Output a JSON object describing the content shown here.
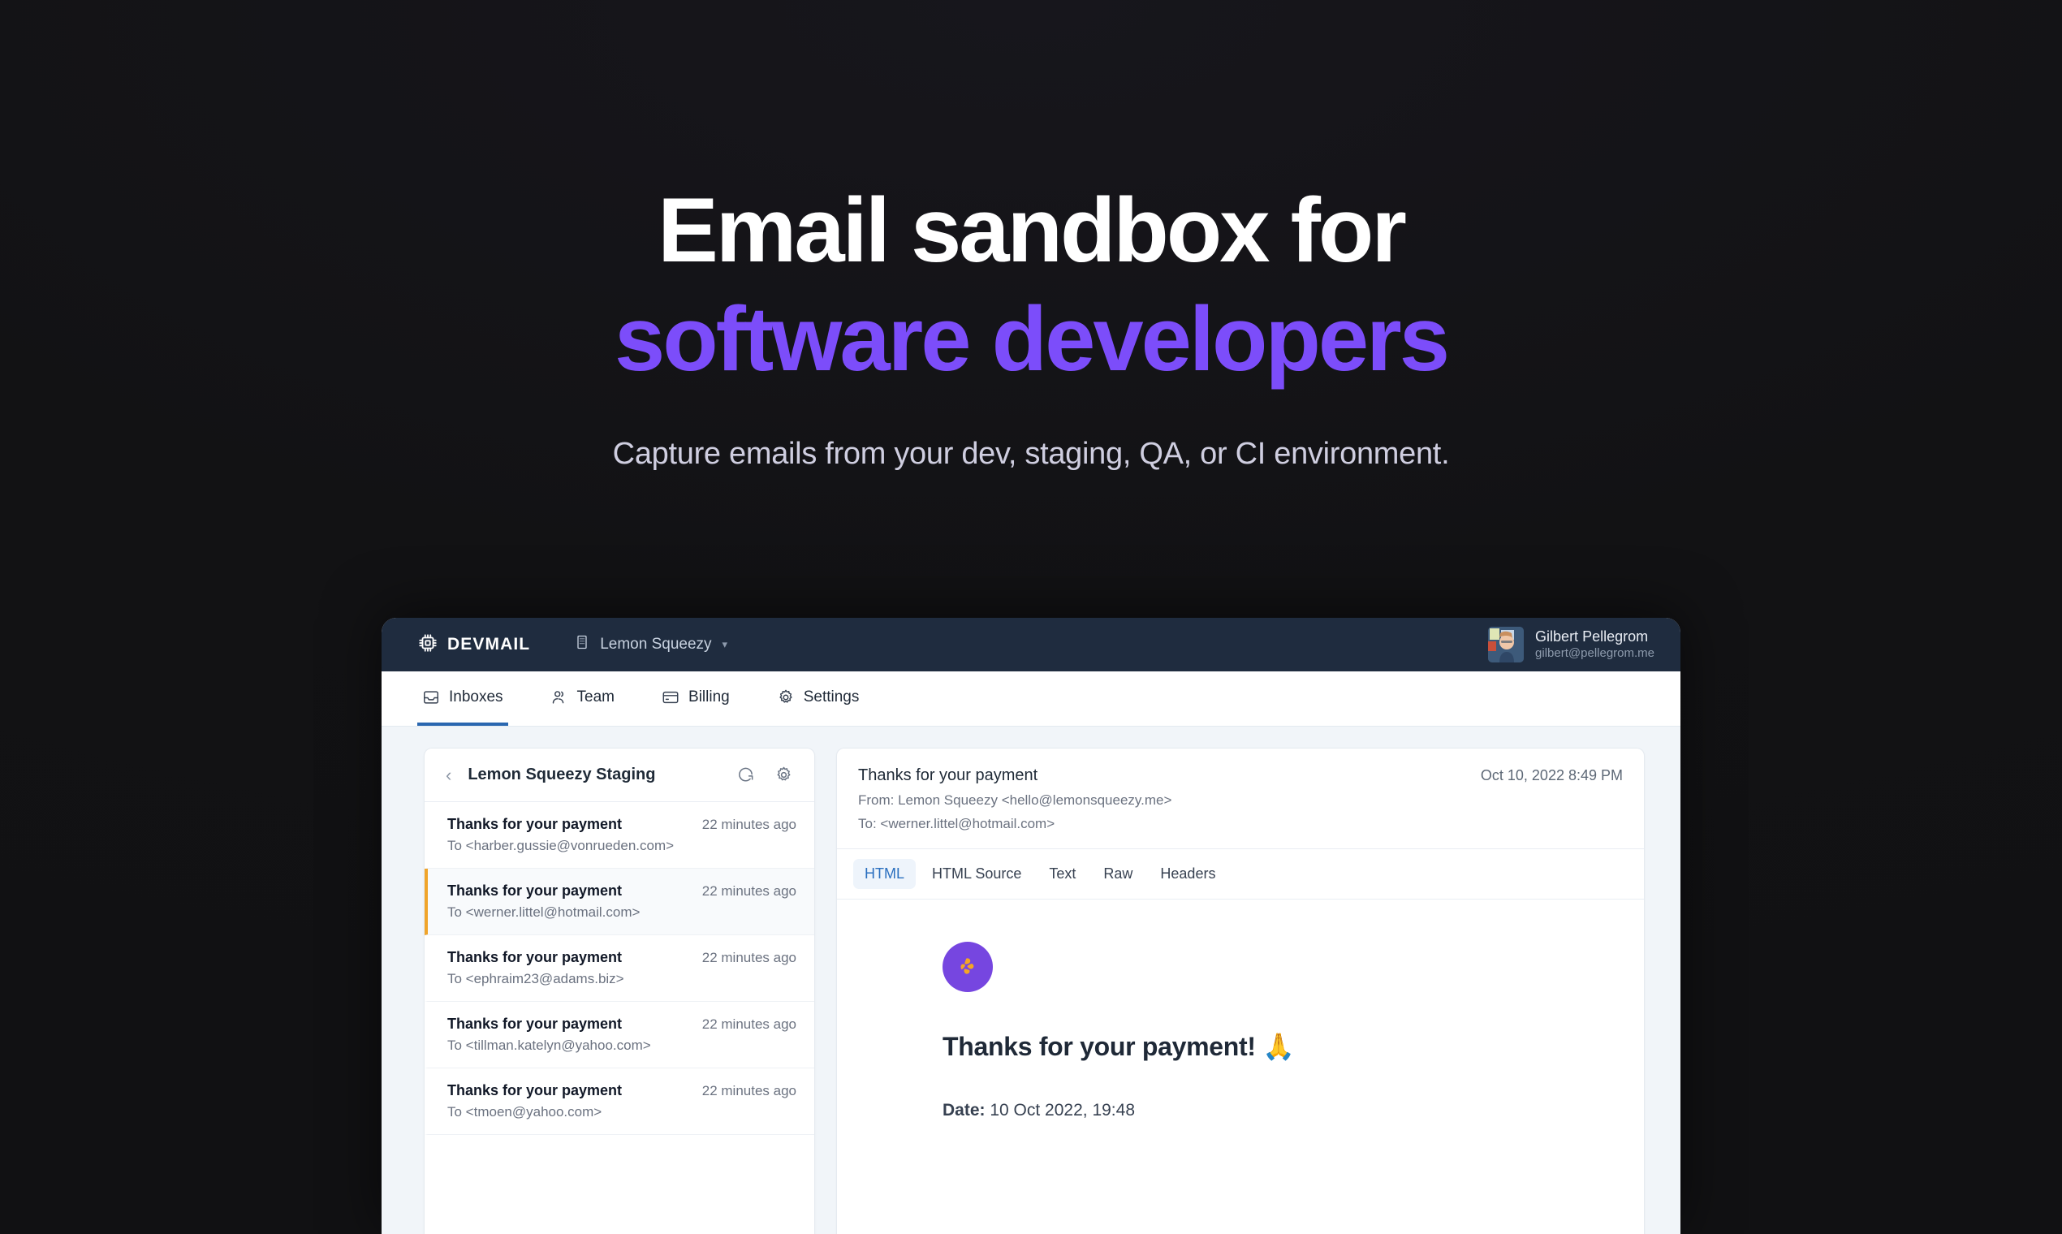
{
  "hero": {
    "title_line1": "Email sandbox for",
    "title_line2": "software developers",
    "subtitle": "Capture emails from your dev, staging, QA, or CI environment.",
    "accent_color": "#7c4dfa",
    "background_color": "#121214"
  },
  "app": {
    "topbar": {
      "brand": "DEVMAIL",
      "org_name": "Lemon Squeezy",
      "org_chevron": "⌄",
      "user_name": "Gilbert Pellegrom",
      "user_email": "gilbert@pellegrom.me",
      "background_color": "#1f2c3f"
    },
    "nav": {
      "tabs": [
        {
          "label": "Inboxes",
          "icon": "inbox-icon",
          "active": true
        },
        {
          "label": "Team",
          "icon": "users-icon",
          "active": false
        },
        {
          "label": "Billing",
          "icon": "credit-card-icon",
          "active": false
        },
        {
          "label": "Settings",
          "icon": "gear-icon",
          "active": false
        }
      ],
      "active_underline_color": "#2a67b0"
    },
    "inbox_list": {
      "title": "Lemon Squeezy Staging",
      "back_label": "‹",
      "refresh_icon": "refresh-icon",
      "settings_icon": "gear-icon",
      "selected_accent_color": "#f0a42a",
      "items": [
        {
          "subject": "Thanks for your payment",
          "time": "22 minutes ago",
          "to": "To <harber.gussie@vonrueden.com>",
          "selected": false
        },
        {
          "subject": "Thanks for your payment",
          "time": "22 minutes ago",
          "to": "To <werner.littel@hotmail.com>",
          "selected": true
        },
        {
          "subject": "Thanks for your payment",
          "time": "22 minutes ago",
          "to": "To <ephraim23@adams.biz>",
          "selected": false
        },
        {
          "subject": "Thanks for your payment",
          "time": "22 minutes ago",
          "to": "To <tillman.katelyn@yahoo.com>",
          "selected": false
        },
        {
          "subject": "Thanks for your payment",
          "time": "22 minutes ago",
          "to": "To <tmoen@yahoo.com>",
          "selected": false
        }
      ]
    },
    "message": {
      "subject": "Thanks for your payment",
      "date": "Oct 10, 2022 8:49 PM",
      "from": "From: Lemon Squeezy <hello@lemonsqueezy.me>",
      "to": "To: <werner.littel@hotmail.com>",
      "view_tabs": [
        {
          "label": "HTML",
          "active": true
        },
        {
          "label": "HTML Source",
          "active": false
        },
        {
          "label": "Text",
          "active": false
        },
        {
          "label": "Raw",
          "active": false
        },
        {
          "label": "Headers",
          "active": false
        }
      ],
      "body": {
        "logo_icon": "lemon-squeezy-logo",
        "logo_bg_color": "#7646e0",
        "logo_mark_color": "#f5a623",
        "heading": "Thanks for your payment! 🙏",
        "date_label": "Date:",
        "date_value": "10 Oct 2022, 19:48"
      }
    }
  }
}
